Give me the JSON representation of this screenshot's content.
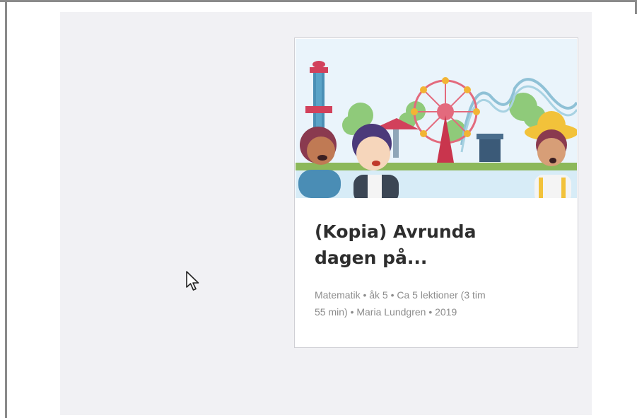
{
  "card": {
    "title_line1": "(Kopia) Avrunda",
    "title_line2": "dagen på...",
    "meta_line1": "Matematik • åk 5 • Ca 5 lektioner (3 tim",
    "meta_line2": "55 min) • Maria Lundgren • 2019",
    "illustration": "amusement-park-illustration"
  },
  "colors": {
    "panel_background": "#f1f1f4",
    "title": "#2d2d2d",
    "meta": "#8c8c8c",
    "card_border": "#cfcfd4"
  },
  "cursor": {
    "icon": "mouse-pointer-icon"
  }
}
